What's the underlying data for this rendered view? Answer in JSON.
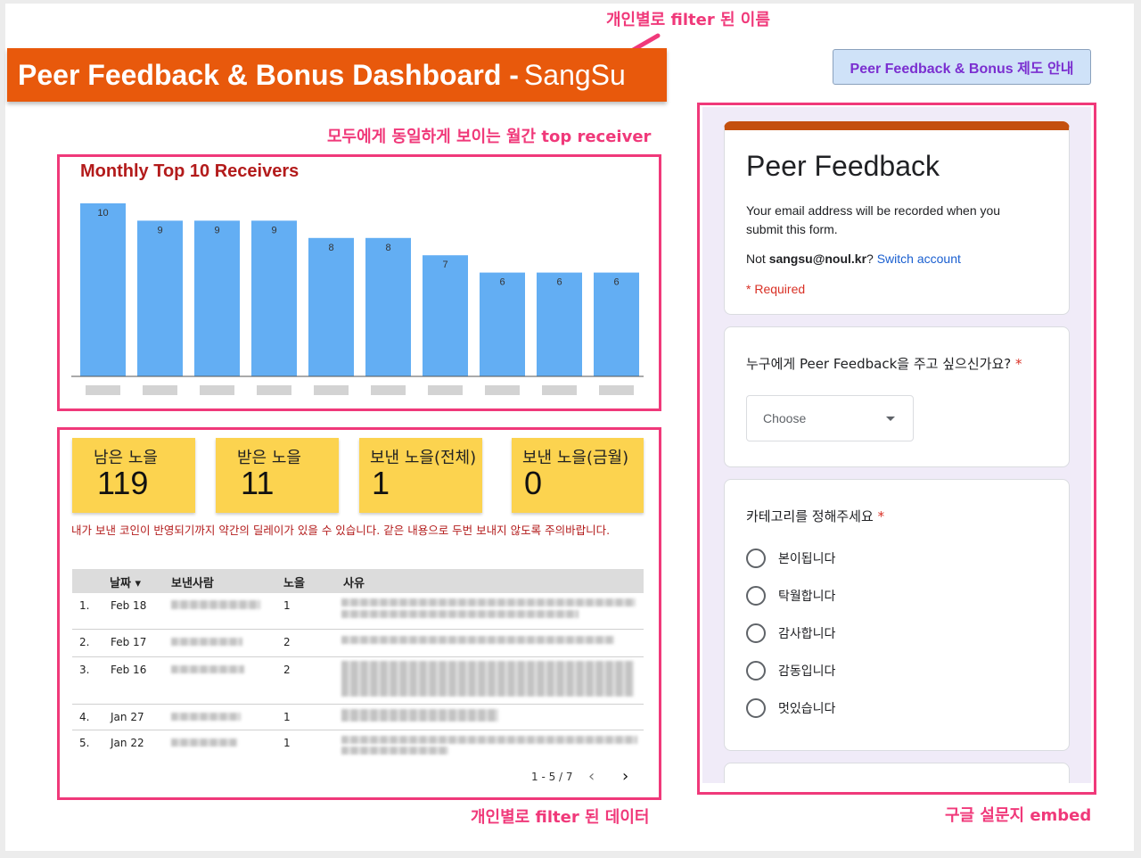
{
  "header": {
    "title": "Peer Feedback & Bonus Dashboard -",
    "name": "SangSu",
    "guide_button": "Peer Feedback & Bonus 제도 안내"
  },
  "annotations": {
    "name_note": "개인별로 filter 된 이름",
    "top_receiver_note": "모두에게 동일하게 보이는 월간 top receiver",
    "data_note": "개인별로 filter 된 데이터",
    "form_note": "구글 설문지 embed"
  },
  "chart_data": {
    "type": "bar",
    "title": "Monthly Top 10 Receivers",
    "categories": [
      "",
      "",
      "",
      "",
      "",
      "",
      "",
      "",
      "",
      ""
    ],
    "values": [
      10,
      9,
      9,
      9,
      8,
      8,
      7,
      6,
      6,
      6
    ],
    "ylim": [
      0,
      10
    ],
    "color": "#63aef3",
    "data_labels": true,
    "category_labels_blurred": true
  },
  "kpis": [
    {
      "label": "남은 노을",
      "value": "119"
    },
    {
      "label": "받은 노을",
      "value": "11"
    },
    {
      "label": "보낸 노을(전체)",
      "value": "1"
    },
    {
      "label": "보낸 노을(금월)",
      "value": "0"
    }
  ],
  "delay_note": "내가 보낸 코인이 반영되기까지 약간의 딜레이가 있을 수 있습니다. 같은 내용으로 두번 보내지 않도록 주의바랍니다.",
  "table": {
    "columns": [
      "날짜 ▾",
      "보낸사람",
      "노을",
      "사유"
    ],
    "rows": [
      {
        "index": "1.",
        "date": "Feb 18",
        "sender": "",
        "amount": "1",
        "reason": ""
      },
      {
        "index": "2.",
        "date": "Feb 17",
        "sender": "",
        "amount": "2",
        "reason": ""
      },
      {
        "index": "3.",
        "date": "Feb 16",
        "sender": "",
        "amount": "2",
        "reason": ""
      },
      {
        "index": "4.",
        "date": "Jan 27",
        "sender": "",
        "amount": "1",
        "reason": ""
      },
      {
        "index": "5.",
        "date": "Jan 22",
        "sender": "",
        "amount": "1",
        "reason": ""
      }
    ],
    "pagination": "1 - 5 / 7"
  },
  "form": {
    "title": "Peer Feedback",
    "email_note": "Your email address will be recorded when you submit this form.",
    "account_prefix": "Not ",
    "account_email": "sangsu@noul.kr",
    "account_suffix": "?",
    "switch_account": "Switch account",
    "required_note": "* Required",
    "q1": "누구에게 Peer Feedback을 주고 싶으신가요?",
    "q1_placeholder": "Choose",
    "q2": "카테고리를 정해주세요",
    "required_star": "*",
    "q2_options": [
      "본이됩니다",
      "탁월합니다",
      "감사합니다",
      "감동입니다",
      "멋있습니다"
    ]
  },
  "colors": {
    "accent": "#f0397a",
    "header_bg": "#e8590c",
    "kpi_bg": "#fcd34f",
    "bar": "#63aef3",
    "form_accent": "#c4500e"
  }
}
